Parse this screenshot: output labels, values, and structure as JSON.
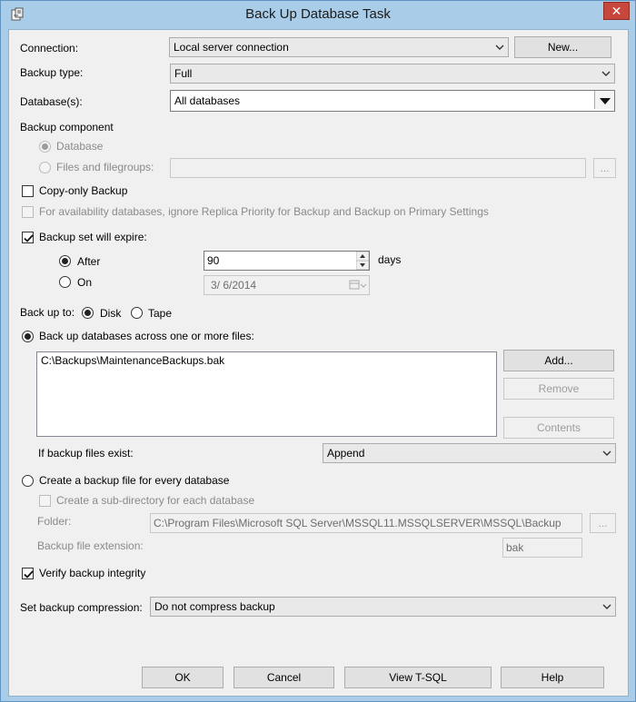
{
  "window": {
    "title": "Back Up Database Task",
    "close_glyph": "✕"
  },
  "connection": {
    "label": "Connection:",
    "value": "Local server connection",
    "new_button": "New..."
  },
  "backup_type": {
    "label": "Backup type:",
    "value": "Full"
  },
  "databases": {
    "label": "Database(s):",
    "value": "All databases"
  },
  "backup_component": {
    "label": "Backup component",
    "database_option": "Database",
    "files_option": "Files and filegroups:",
    "browse_button": "..."
  },
  "copy_only": {
    "label": "Copy-only Backup",
    "checked": false
  },
  "availability": {
    "label": "For availability databases, ignore Replica Priority for Backup and Backup on Primary Settings",
    "checked": false
  },
  "expire": {
    "label": "Backup set will expire:",
    "checked": true,
    "after_label": "After",
    "after_value": "90",
    "days_label": "days",
    "on_label": "On",
    "on_value": "3/  6/2014"
  },
  "backup_to": {
    "label": "Back up to:",
    "disk": "Disk",
    "tape": "Tape"
  },
  "across_files": {
    "label": "Back up databases across one or more files:",
    "files": [
      "C:\\Backups\\MaintenanceBackups.bak"
    ],
    "add_button": "Add...",
    "remove_button": "Remove",
    "contents_button": "Contents",
    "if_exist_label": "If backup files exist:",
    "if_exist_value": "Append"
  },
  "per_database": {
    "label": "Create a backup file for every database",
    "subdir_label": "Create a sub-directory for each database",
    "folder_label": "Folder:",
    "folder_value": "C:\\Program Files\\Microsoft SQL Server\\MSSQL11.MSSQLSERVER\\MSSQL\\Backup",
    "folder_browse": "...",
    "extension_label": "Backup file extension:",
    "extension_value": "bak"
  },
  "verify": {
    "label": "Verify backup integrity",
    "checked": true
  },
  "compression": {
    "label": "Set backup compression:",
    "value": "Do not compress backup"
  },
  "footer": {
    "ok": "OK",
    "cancel": "Cancel",
    "view_tsql": "View T-SQL",
    "help": "Help"
  }
}
